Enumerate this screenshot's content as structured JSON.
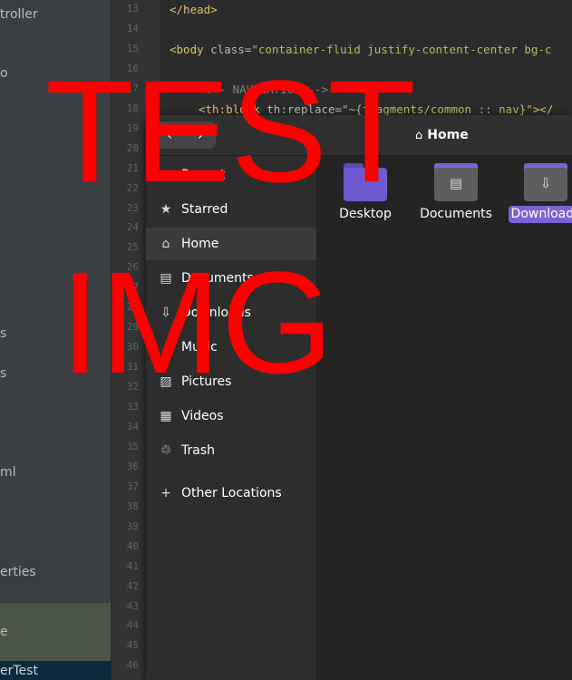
{
  "ide": {
    "project_tree": [
      "troller",
      "o",
      "s",
      "s",
      "ml",
      "erties",
      "e",
      "erTest"
    ],
    "gutter_lines": [
      "13",
      "14",
      "15",
      "16",
      "17",
      "18",
      "19",
      "20",
      "21",
      "22",
      "23",
      "24",
      "25",
      "26",
      "27",
      "28",
      "29",
      "30",
      "31",
      "32",
      "33",
      "34",
      "35",
      "36",
      "37",
      "38",
      "39",
      "40",
      "41",
      "42",
      "43",
      "44",
      "45",
      "46"
    ],
    "code": {
      "line13_tag": "</head>",
      "line15_open": "<body ",
      "line15_attr": "class=",
      "line15_str": "\"container-fluid justify-content-center bg-c",
      "line17_comment": "<!-- NAVIGATION -->",
      "line18_tag": "<th:block ",
      "line18_attr": "th:replace=",
      "line18_str": "\"~{fragments/common :: nav}\"",
      "line18_end": "></"
    }
  },
  "file_manager": {
    "nav": {
      "back": "‹",
      "forward": "›"
    },
    "location": {
      "icon": "home-icon",
      "label": "Home"
    },
    "sidebar": [
      {
        "label": "Recent",
        "icon": "clock-icon"
      },
      {
        "label": "Starred",
        "icon": "star-icon"
      },
      {
        "label": "Home",
        "icon": "home-icon",
        "active": true
      },
      {
        "label": "Documents",
        "icon": "document-icon"
      },
      {
        "label": "Downloads",
        "icon": "download-icon"
      },
      {
        "label": "Music",
        "icon": "music-icon"
      },
      {
        "label": "Pictures",
        "icon": "picture-icon"
      },
      {
        "label": "Videos",
        "icon": "video-icon"
      },
      {
        "label": "Trash",
        "icon": "trash-icon"
      },
      {
        "label": "Other Locations",
        "icon": "plus-icon"
      }
    ],
    "items": [
      {
        "label": "Desktop",
        "icon": "desktop-folder-icon",
        "color": "#6e5bd1"
      },
      {
        "label": "Documents",
        "icon": "documents-folder-icon",
        "color": "#5e5e5e",
        "accent": "#7b63d4"
      },
      {
        "label": "Downloads",
        "icon": "downloads-folder-icon",
        "color": "#5e5e5e",
        "accent": "#7b63d4",
        "selected": true
      }
    ]
  },
  "watermark": {
    "line1": "TEST",
    "line2": "IMG",
    "color": "#ff0000"
  }
}
